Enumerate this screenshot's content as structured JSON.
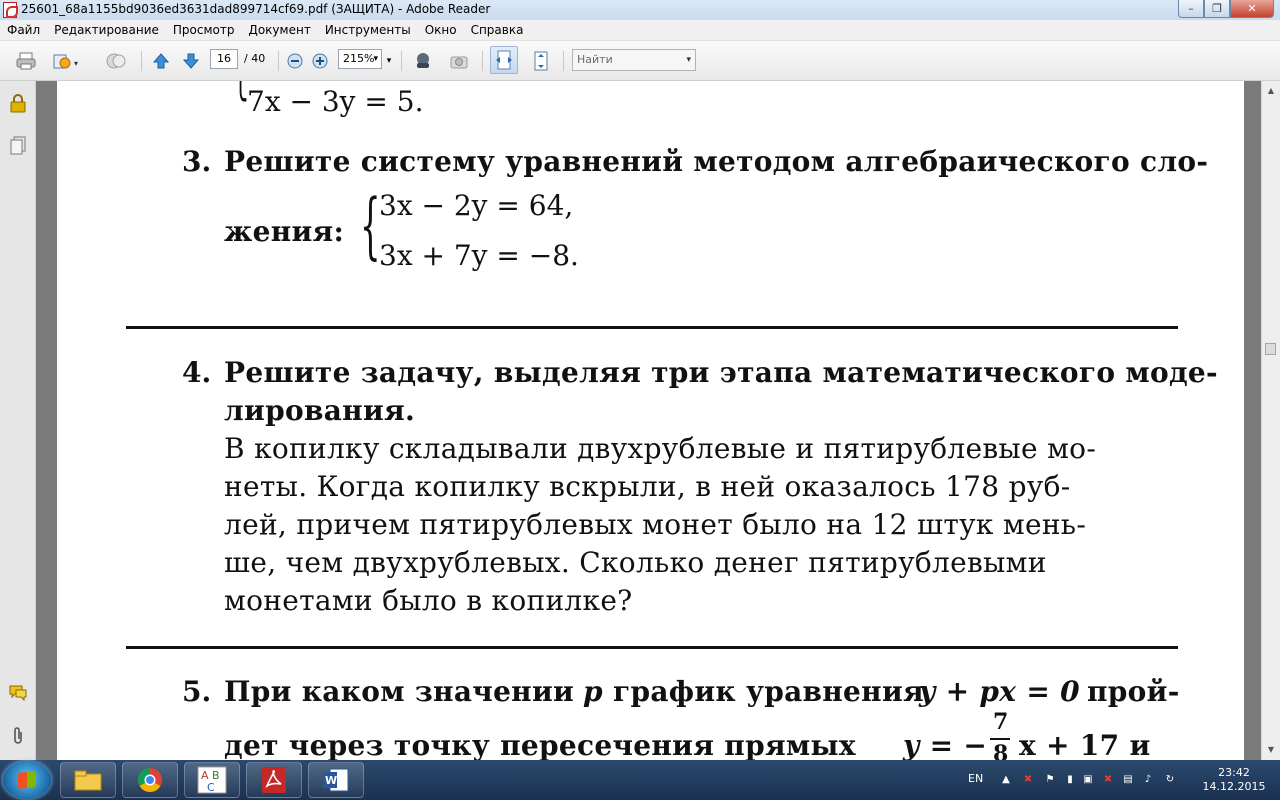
{
  "window": {
    "title": "25601_68a1155bd9036ed3631dad899714cf69.pdf (ЗАЩИТА) - Adobe Reader",
    "min_label": "–",
    "max_label": "❐",
    "close_label": "✕"
  },
  "menu": [
    "Файл",
    "Редактирование",
    "Просмотр",
    "Документ",
    "Инструменты",
    "Окно",
    "Справка"
  ],
  "toolbar": {
    "page_current": "16",
    "page_total": "/ 40",
    "zoom": "215%",
    "find_placeholder": "Найти"
  },
  "document": {
    "prev_eq": "7x − 3y = 5.",
    "task3": {
      "number": "3.",
      "line1": "Решите систему уравнений методом алгебраического сло-",
      "line2": "жения:",
      "eq1": "3x − 2y = 64,",
      "eq2": "3x + 7y = −8."
    },
    "task4": {
      "number": "4.",
      "lines": [
        "Решите задачу, выделяя три этапа математического моде-",
        "лирования.",
        "В копилку складывали двухрублевые и пятирублевые мо-",
        "неты. Когда копилку вскрыли, в ней оказалось 178 руб-",
        "лей, причем пятирублевых монет было на 12 штук мень-",
        "ше, чем двухрублевых. Сколько денег пятирублевыми",
        "монетами было в копилке?"
      ]
    },
    "task5": {
      "number": "5.",
      "line1_a": "При каком значении",
      "line1_p": "p",
      "line1_b": "график уравнения",
      "line1_eq": "y + px = 0",
      "line1_c": "прой-",
      "line2_a": "дет через точку пересечения прямых",
      "line2_eq": "y = −",
      "frac_num": "7",
      "frac_den": "8",
      "line2_b": "x + 17 и"
    }
  },
  "taskbar": {
    "lang": "EN",
    "time": "23:42",
    "date": "14.12.2015"
  }
}
